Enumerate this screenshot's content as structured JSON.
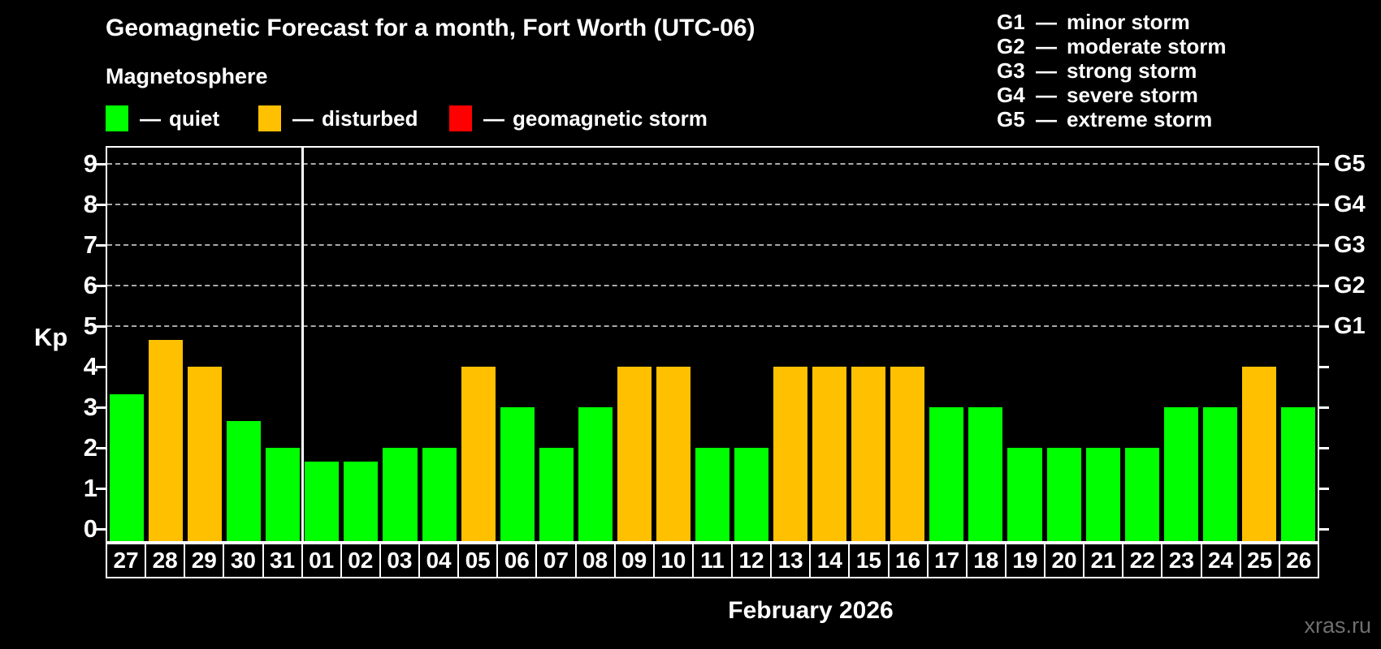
{
  "dash": "—",
  "header": {
    "title": "Geomagnetic Forecast for a month, Fort Worth (UTC-06)",
    "subtitle": "Magnetosphere",
    "legend": [
      {
        "label": "quiet",
        "status": "quiet",
        "color": "#00ff00"
      },
      {
        "label": "disturbed",
        "status": "disturbed",
        "color": "#ffc000"
      },
      {
        "label": "geomagnetic storm",
        "status": "storm",
        "color": "#ff0000"
      }
    ]
  },
  "storm_scale": [
    {
      "code": "G1",
      "label": "minor storm",
      "kp": 5
    },
    {
      "code": "G2",
      "label": "moderate storm",
      "kp": 6
    },
    {
      "code": "G3",
      "label": "strong storm",
      "kp": 7
    },
    {
      "code": "G4",
      "label": "severe storm",
      "kp": 8
    },
    {
      "code": "G5",
      "label": "extreme storm",
      "kp": 9
    }
  ],
  "chart_data": {
    "type": "bar",
    "title": "Geomagnetic Forecast for a month, Fort Worth (UTC-06)",
    "subtitle": "Magnetosphere",
    "ylabel": "Kp",
    "xlabel": "February 2026",
    "ylim": [
      0,
      9
    ],
    "yticks": [
      0,
      1,
      2,
      3,
      4,
      5,
      6,
      7,
      8,
      9
    ],
    "grid": "dashed horizontal lines at Kp 5 through 9 (G1-G5 levels)",
    "legend_position": "top-left",
    "colors": {
      "quiet": "#00ff00",
      "disturbed": "#ffc000",
      "storm": "#ff0000"
    },
    "month_separator_after": "31",
    "days": [
      {
        "label": "27",
        "kp": 3.33,
        "status": "quiet"
      },
      {
        "label": "28",
        "kp": 4.67,
        "status": "disturbed"
      },
      {
        "label": "29",
        "kp": 4,
        "status": "disturbed"
      },
      {
        "label": "30",
        "kp": 2.67,
        "status": "quiet"
      },
      {
        "label": "31",
        "kp": 2,
        "status": "quiet"
      },
      {
        "label": "01",
        "kp": 1.67,
        "status": "quiet"
      },
      {
        "label": "02",
        "kp": 1.67,
        "status": "quiet"
      },
      {
        "label": "03",
        "kp": 2,
        "status": "quiet"
      },
      {
        "label": "04",
        "kp": 2,
        "status": "quiet"
      },
      {
        "label": "05",
        "kp": 4,
        "status": "disturbed"
      },
      {
        "label": "06",
        "kp": 3,
        "status": "quiet"
      },
      {
        "label": "07",
        "kp": 2,
        "status": "quiet"
      },
      {
        "label": "08",
        "kp": 3,
        "status": "quiet"
      },
      {
        "label": "09",
        "kp": 4,
        "status": "disturbed"
      },
      {
        "label": "10",
        "kp": 4,
        "status": "disturbed"
      },
      {
        "label": "11",
        "kp": 2,
        "status": "quiet"
      },
      {
        "label": "12",
        "kp": 2,
        "status": "quiet"
      },
      {
        "label": "13",
        "kp": 4,
        "status": "disturbed"
      },
      {
        "label": "14",
        "kp": 4,
        "status": "disturbed"
      },
      {
        "label": "15",
        "kp": 4,
        "status": "disturbed"
      },
      {
        "label": "16",
        "kp": 4,
        "status": "disturbed"
      },
      {
        "label": "17",
        "kp": 3,
        "status": "quiet"
      },
      {
        "label": "18",
        "kp": 3,
        "status": "quiet"
      },
      {
        "label": "19",
        "kp": 2,
        "status": "quiet"
      },
      {
        "label": "20",
        "kp": 2,
        "status": "quiet"
      },
      {
        "label": "21",
        "kp": 2,
        "status": "quiet"
      },
      {
        "label": "22",
        "kp": 2,
        "status": "quiet"
      },
      {
        "label": "23",
        "kp": 3,
        "status": "quiet"
      },
      {
        "label": "24",
        "kp": 3,
        "status": "quiet"
      },
      {
        "label": "25",
        "kp": 4,
        "status": "disturbed"
      },
      {
        "label": "26",
        "kp": 3,
        "status": "quiet"
      }
    ]
  },
  "footer": {
    "watermark": "xras.ru"
  }
}
